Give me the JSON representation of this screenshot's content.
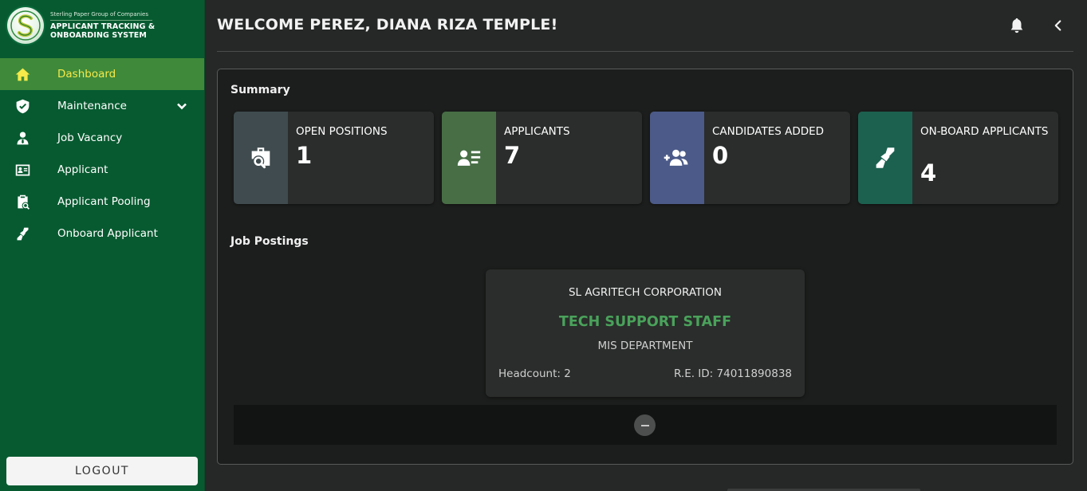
{
  "brand": {
    "group_name": "Sterling Paper Group of Companies",
    "system_name_line1": "APPLICANT TRACKING &",
    "system_name_line2": "ONBOARDING SYSTEM"
  },
  "sidebar": {
    "items": [
      {
        "label": "Dashboard",
        "icon": "home-icon",
        "active": true
      },
      {
        "label": "Maintenance",
        "icon": "shield-check-icon",
        "has_chevron": true
      },
      {
        "label": "Job Vacancy",
        "icon": "user-tie-icon"
      },
      {
        "label": "Applicant",
        "icon": "id-card-icon"
      },
      {
        "label": "Applicant Pooling",
        "icon": "clipboard-search-icon"
      },
      {
        "label": "Onboard Applicant",
        "icon": "handshake-icon"
      }
    ],
    "logout_label": "LOGOUT"
  },
  "header": {
    "welcome": "WELCOME PEREZ, DIANA RIZA TEMPLE!",
    "bell_icon": "bell-icon",
    "collapse_icon": "chevron-left-icon"
  },
  "summary": {
    "title": "Summary",
    "cards": [
      {
        "label": "OPEN POSITIONS",
        "value": "1",
        "color": "#3f4b4f",
        "icon": "briefcase-search-icon"
      },
      {
        "label": "APPLICANTS",
        "value": "7",
        "color": "#476e45",
        "icon": "user-list-icon"
      },
      {
        "label": "CANDIDATES ADDED",
        "value": "0",
        "color": "#4b5a88",
        "icon": "user-plus-icon"
      },
      {
        "label": "ON-BOARD APPLICANTS",
        "value": "4",
        "color": "#1c6150",
        "icon": "handshake-icon"
      }
    ]
  },
  "job_postings": {
    "title": "Job Postings",
    "items": [
      {
        "company": "SL AGRITECH CORPORATION",
        "position": "TECH SUPPORT STAFF",
        "department": "MIS DEPARTMENT",
        "headcount": "Headcount: 2",
        "re_id": "R.E. ID: 74011890838"
      }
    ]
  },
  "colors": {
    "sidebar_bg": "#075a30",
    "active_item_bg": "#3e8a3a",
    "active_item_text": "#f6e94a",
    "job_title": "#4aa25b"
  }
}
